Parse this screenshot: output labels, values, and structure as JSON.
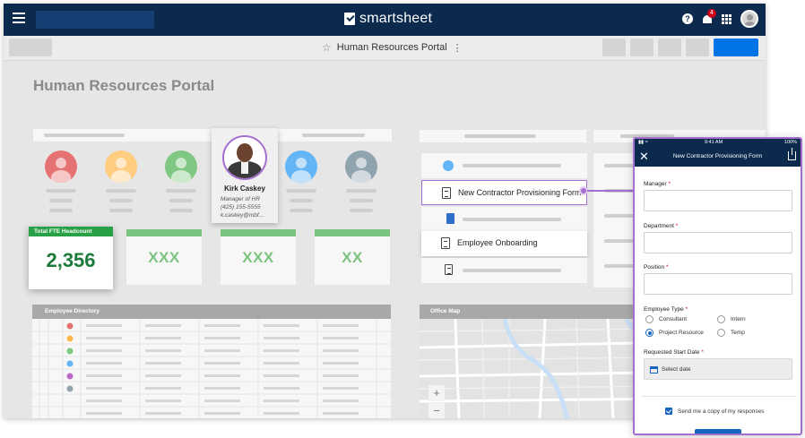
{
  "app": {
    "brand": "smartsheet",
    "notification_count": "4",
    "page_title": "Human Resources Portal",
    "toolbar_title": "Human Resources Portal"
  },
  "headcount": {
    "label": "Total FTE Headcount",
    "value": "2,356"
  },
  "metrics": [
    "XXX",
    "XXX",
    "XX"
  ],
  "contact_card": {
    "name": "Kirk Caskey",
    "role": "Manager of HR",
    "phone": "(425) 155-5555",
    "email": "k.caskey@mbf..."
  },
  "avatar_colors": [
    "#e57373",
    "#ffcc80",
    "#81c784",
    "#64b5f6",
    "#90a4ae"
  ],
  "forms": {
    "items": [
      {
        "label": "New Contractor Provisioning Form"
      },
      {
        "label": "Employee Onboarding"
      }
    ]
  },
  "directory": {
    "title": "Employee Directory",
    "row_dot_colors": [
      "#e57373",
      "#ffb74d",
      "#81c784",
      "#64b5f6",
      "#ba68c8",
      "#90a4ae"
    ]
  },
  "map": {
    "title": "Office Map",
    "zoom_in": "+",
    "zoom_out": "−"
  },
  "phone": {
    "time": "9:41 AM",
    "battery": "100%",
    "title": "New Contractor Provisioning Form",
    "fields": {
      "manager": "Manager",
      "department": "Department",
      "position": "Position",
      "employee_type": "Employee Type",
      "requested_start": "Requested Start Date",
      "required_mark": "*"
    },
    "employee_type_options": [
      "Consultant",
      "Intern",
      "Project Resource",
      "Temp"
    ],
    "selected_employee_type": "Project Resource",
    "date_placeholder": "Select date",
    "copy_label": "Send me a copy of my responses"
  },
  "colors": {
    "nav": "#0b2a4e",
    "primary": "#0073e6",
    "accent_purple": "#a56fd0",
    "metric_green": "#7bc47f",
    "headcount_green": "#27a046"
  }
}
